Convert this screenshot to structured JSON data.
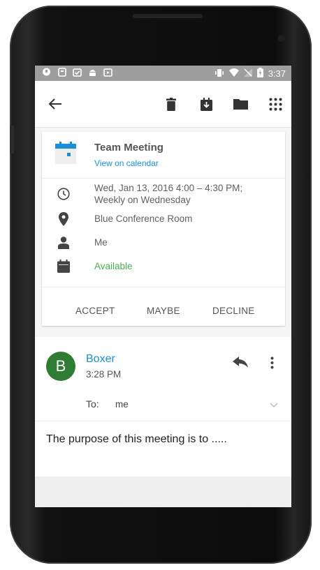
{
  "statusbar": {
    "time": "3:37"
  },
  "event": {
    "title": "Team Meeting",
    "link": "View on calendar",
    "datetime_line1": "Wed, Jan 13, 2016 4:00 – 4:30 PM;",
    "datetime_line2": "Weekly on Wednesday",
    "location": "Blue  Conference Room",
    "organizer": "Me",
    "availability": "Available",
    "availability_color": "#4caf50"
  },
  "rsvp": {
    "accept": "ACCEPT",
    "maybe": "MAYBE",
    "decline": "DECLINE"
  },
  "message": {
    "avatar_letter": "B",
    "sender": "Boxer",
    "time": "3:28 PM",
    "to_label": "To:",
    "to_value": "me",
    "body": "The purpose of this meeting is to ....."
  },
  "colors": {
    "accent": "#1a8fd8",
    "avatar": "#2e7d32",
    "calendar_icon": "#1a8fd8"
  },
  "icons": [
    "back-arrow-icon",
    "trash-icon",
    "archive-down-icon",
    "folder-icon",
    "apps-grid-icon",
    "calendar-icon",
    "clock-icon",
    "location-pin-icon",
    "person-icon",
    "calendar-small-icon",
    "reply-icon",
    "more-vert-icon",
    "chevron-down-icon"
  ]
}
